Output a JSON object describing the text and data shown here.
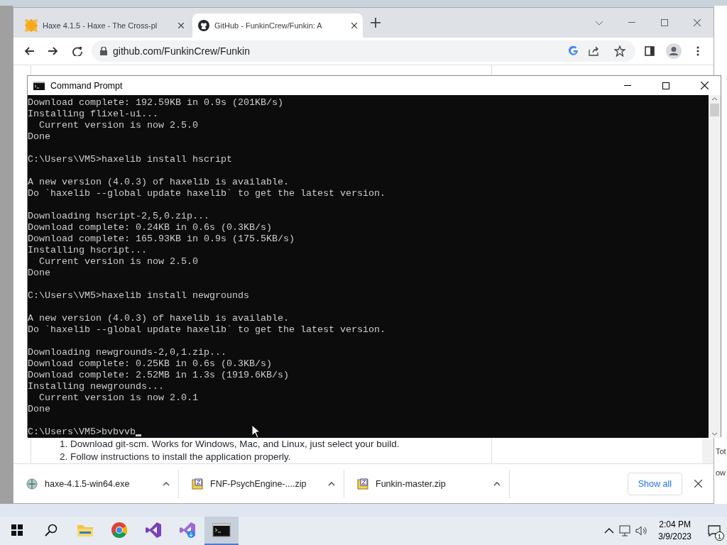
{
  "browser": {
    "tabs": [
      {
        "title": "Haxe 4.1.5 - Haxe - The Cross-pl",
        "kind": "haxe",
        "selected": false
      },
      {
        "title": "GitHub - FunkinCrew/Funkin: A",
        "kind": "github",
        "selected": true
      }
    ],
    "address": "github.com/FunkinCrew/Funkin",
    "page_lines": [
      "1. Download git-scm. Works for Windows, Mac, and Linux, just select your build.",
      "2. Follow instructions to install the application properly."
    ],
    "downloads": [
      {
        "name": "haxe-4.1.5-win64.exe",
        "kind": "exe"
      },
      {
        "name": "FNF-PsychEngine-....zip",
        "kind": "zip"
      },
      {
        "name": "Funkin-master.zip",
        "kind": "zip"
      }
    ],
    "show_all": "Show all"
  },
  "console": {
    "title": "Command Prompt",
    "lines": [
      {
        "kind": "text",
        "text": "Download complete: 192.59KB in 0.9s (201KB/s)"
      },
      {
        "kind": "text",
        "text": "Installing flixel-ui..."
      },
      {
        "kind": "text",
        "text": "  Current version is now 2.5.0"
      },
      {
        "kind": "text",
        "text": "Done"
      },
      {
        "kind": "blank"
      },
      {
        "kind": "text",
        "text": "C:\\Users\\VM5>haxelib install hscript"
      },
      {
        "kind": "blank"
      },
      {
        "kind": "text",
        "text": "A new version (4.0.3) of haxelib is available."
      },
      {
        "kind": "text",
        "text": "Do `haxelib --global update haxelib` to get the latest version."
      },
      {
        "kind": "blank"
      },
      {
        "kind": "text",
        "text": "Downloading hscript-2,5,0.zip..."
      },
      {
        "kind": "text",
        "text": "Download complete: 0.24KB in 0.6s (0.3KB/s)"
      },
      {
        "kind": "text",
        "text": "Download complete: 165.93KB in 0.9s (175.5KB/s)"
      },
      {
        "kind": "text",
        "text": "Installing hscript..."
      },
      {
        "kind": "text",
        "text": "  Current version is now 2.5.0"
      },
      {
        "kind": "text",
        "text": "Done"
      },
      {
        "kind": "blank"
      },
      {
        "kind": "text",
        "text": "C:\\Users\\VM5>haxelib install newgrounds"
      },
      {
        "kind": "blank"
      },
      {
        "kind": "text",
        "text": "A new version (4.0.3) of haxelib is available."
      },
      {
        "kind": "text",
        "text": "Do `haxelib --global update haxelib` to get the latest version."
      },
      {
        "kind": "blank"
      },
      {
        "kind": "text",
        "text": "Downloading newgrounds-2,0,1.zip..."
      },
      {
        "kind": "text",
        "text": "Download complete: 0.25KB in 0.6s (0.3KB/s)"
      },
      {
        "kind": "text",
        "text": "Download complete: 2.52MB in 1.3s (1919.6KB/s)"
      },
      {
        "kind": "text",
        "text": "Installing newgrounds..."
      },
      {
        "kind": "text",
        "text": "  Current version is now 2.0.1"
      },
      {
        "kind": "text",
        "text": "Done"
      },
      {
        "kind": "blank"
      },
      {
        "kind": "text",
        "text": "C:\\Users\\VM5>bvbvvb",
        "cursor": true
      }
    ]
  },
  "behind_window": {
    "fragments": [
      "Tot",
      "ow"
    ]
  },
  "taskbar": {
    "apps": [
      {
        "kind": "explorer",
        "selected": false
      },
      {
        "kind": "chrome",
        "selected": false
      },
      {
        "kind": "vs",
        "selected": false
      },
      {
        "kind": "vsinstaller",
        "selected": false
      },
      {
        "kind": "cmd",
        "selected": true
      }
    ],
    "time": "2:04 PM",
    "date": "3/9/2023",
    "notifications": "1"
  }
}
